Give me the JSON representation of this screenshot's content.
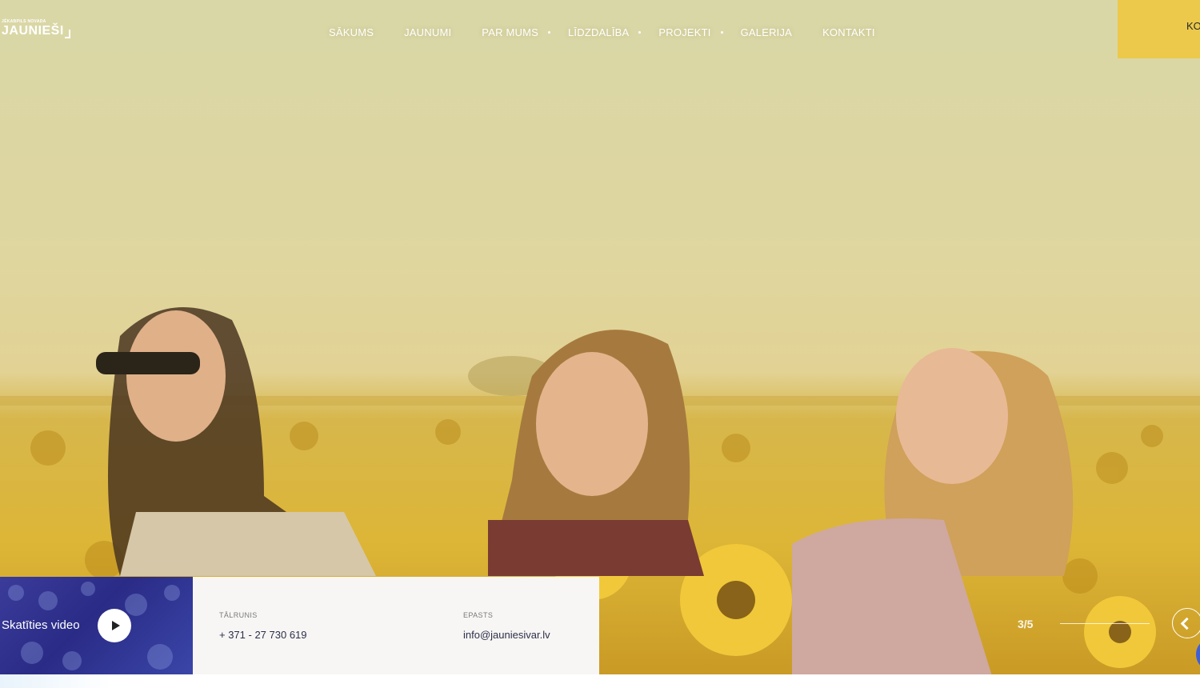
{
  "header": {
    "logo_small": "JĒKABPILS NOVADA",
    "logo_big": "JAUNIEŠI",
    "nav": [
      {
        "label": "SĀKUMS",
        "has_dropdown": false
      },
      {
        "label": "JAUNUMI",
        "has_dropdown": false
      },
      {
        "label": "PAR MUMS",
        "has_dropdown": true
      },
      {
        "label": "LĪDZDALĪBA",
        "has_dropdown": true
      },
      {
        "label": "PROJEKTI",
        "has_dropdown": true
      },
      {
        "label": "GALERIJA",
        "has_dropdown": false
      },
      {
        "label": "KONTAKTI",
        "has_dropdown": false
      }
    ],
    "cta_label": "KO",
    "cta_color": "#ecc94b"
  },
  "video": {
    "label": "Skatīties video",
    "play_icon": "play-icon"
  },
  "contacts": {
    "phone_label": "TĀLRUNIS",
    "phone_value": "+ 371 - 27 730 619",
    "email_label": "EPASTS",
    "email_value": "info@jauniesivar.lv"
  },
  "slider": {
    "counter": "3/5",
    "current": 3,
    "total": 5,
    "prev_icon": "chevron-left-icon"
  },
  "colors": {
    "accent_yellow": "#ecc94b",
    "video_panel": "#2a2b86",
    "contact_panel": "#f7f6f4",
    "float_button": "#3f5fd9"
  }
}
